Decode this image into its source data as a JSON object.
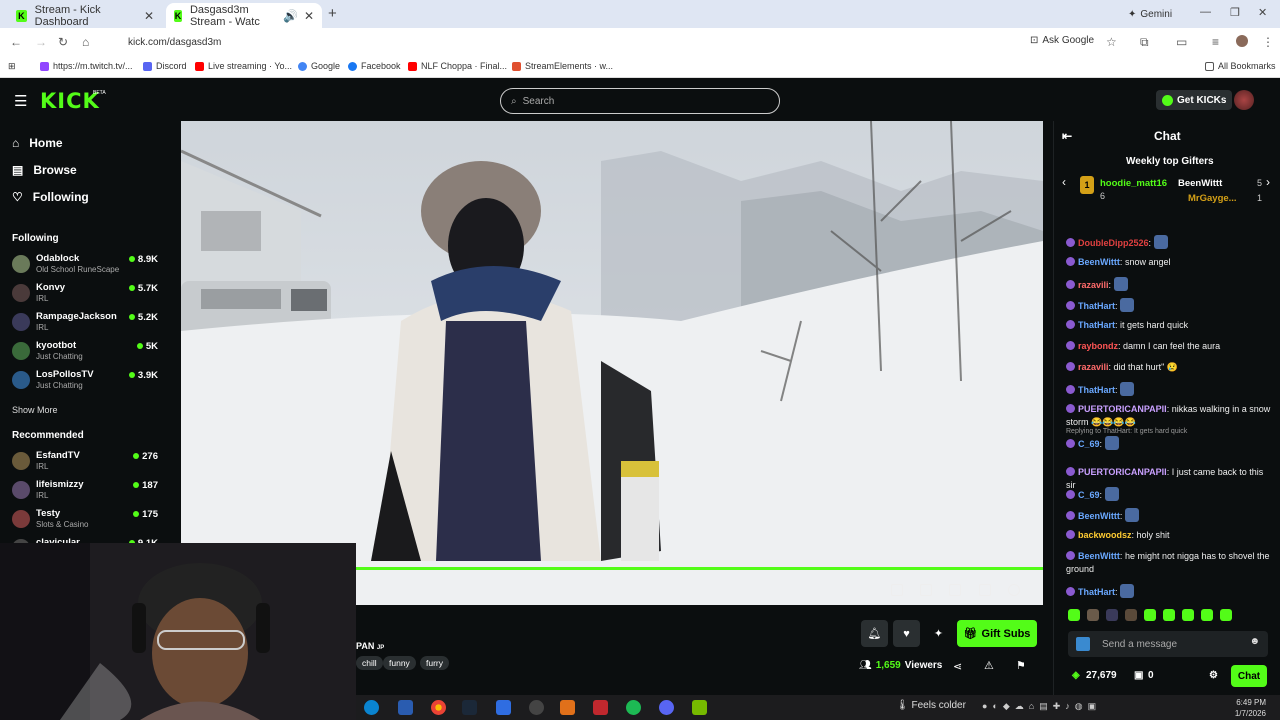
{
  "browser": {
    "tabs": [
      {
        "title": "Stream - Kick Dashboard"
      },
      {
        "title": "Dasgasd3m Stream - Watc"
      }
    ],
    "url": "kick.com/dasgasd3m",
    "gemini_label": "Gemini",
    "ask_google_label": "Ask Google",
    "bookmarks": [
      "https://m.twitch.tv/...",
      "Discord",
      "Live streaming · Yo...",
      "Google",
      "Facebook",
      "NLF Choppa · Final...",
      "StreamElements · w..."
    ],
    "all_bookmarks_label": "All Bookmarks"
  },
  "kick": {
    "logo": "KICK",
    "beta": "BETA",
    "search_placeholder": "Search",
    "get_kicks_label": "Get KICKs"
  },
  "sidebar": {
    "nav": [
      {
        "label": "Home",
        "icon": "home-icon"
      },
      {
        "label": "Browse",
        "icon": "browse-icon"
      },
      {
        "label": "Following",
        "icon": "heart-icon"
      }
    ],
    "following_header": "Following",
    "following": [
      {
        "name": "Odablock",
        "category": "Old School RuneScape",
        "viewers": "8.9K",
        "color": "#6a7a5a"
      },
      {
        "name": "Konvy",
        "category": "IRL",
        "viewers": "5.7K",
        "color": "#4a3a3a"
      },
      {
        "name": "RampageJackson",
        "category": "IRL",
        "viewers": "5.2K",
        "color": "#3a3a5a"
      },
      {
        "name": "kyootbot",
        "category": "Just Chatting",
        "viewers": "5K",
        "color": "#3a6a3a"
      },
      {
        "name": "LosPollosTV",
        "category": "Just Chatting",
        "viewers": "3.9K",
        "color": "#2a5a8a"
      }
    ],
    "show_more_label": "Show More",
    "recommended_header": "Recommended",
    "recommended": [
      {
        "name": "EsfandTV",
        "category": "IRL",
        "viewers": "276",
        "color": "#6a5a3a"
      },
      {
        "name": "lifeismizzy",
        "category": "IRL",
        "viewers": "187",
        "color": "#5a4a6a"
      },
      {
        "name": "Testy",
        "category": "Slots & Casino",
        "viewers": "175",
        "color": "#7a3a3a"
      },
      {
        "name": "clavicular",
        "category": "",
        "viewers": "9.1K",
        "color": "#444"
      }
    ]
  },
  "stream": {
    "title": "PAN",
    "flag": "JP",
    "tags": [
      "chill",
      "funny",
      "furry"
    ],
    "viewers": "1,659",
    "viewers_label": "Viewers",
    "gift_subs_label": "Gift Subs",
    "progress": 1.0
  },
  "chat": {
    "title": "Chat",
    "weekly_header": "Weekly top Gifters",
    "gifters": [
      {
        "rank": "1",
        "name": "hoodie_matt16",
        "count": "6"
      },
      {
        "rank": "",
        "name": "BeenWittt",
        "count": "5"
      },
      {
        "rank": "",
        "name": "MrGayge...",
        "count": "1"
      }
    ],
    "messages": [
      {
        "user": "DoubleDipp2526",
        "text": "",
        "color": "#e04040"
      },
      {
        "user": "BeenWittt",
        "text": "snow angel",
        "color": "#6aa8ff"
      },
      {
        "user": "razavili",
        "text": "",
        "color": "#ff6b6b"
      },
      {
        "user": "ThatHart",
        "text": "",
        "color": "#6aa8ff"
      },
      {
        "user": "ThatHart",
        "text": "it gets hard quick",
        "color": "#6aa8ff"
      },
      {
        "user": "raybondz",
        "text": "damn I can feel the aura",
        "color": "#ff5555"
      },
      {
        "user": "razavili",
        "text": "did that hurt\" 😢",
        "color": "#ff6b6b"
      },
      {
        "user": "ThatHart",
        "text": "",
        "color": "#6aa8ff"
      },
      {
        "user": "PUERTORICANPAPII",
        "text": "nikkas walking in a snow storm 😂😂😂😂",
        "color": "#c9a0ff"
      },
      {
        "user": "C_69",
        "text": "",
        "color": "#6aa8ff",
        "reply": "Replying to ThatHart: It gets hard quick"
      },
      {
        "user": "PUERTORICANPAPII",
        "text": "I just came back to this sir",
        "color": "#c9a0ff"
      },
      {
        "user": "C_69",
        "text": "",
        "color": "#6aa8ff"
      },
      {
        "user": "BeenWittt",
        "text": "",
        "color": "#6aa8ff"
      },
      {
        "user": "backwoodsz",
        "text": "holy shit",
        "color": "#ffcc33"
      },
      {
        "user": "BeenWittt",
        "text": "he might not nigga has to shovel the ground",
        "color": "#6aa8ff"
      },
      {
        "user": "ThatHart",
        "text": "",
        "color": "#6aa8ff"
      }
    ],
    "send_placeholder": "Send a message",
    "kicks_balance": "27,679",
    "gifts_count": "0",
    "chat_button": "Chat"
  },
  "taskbar": {
    "weather": "Feels colder",
    "time": "6:49 PM",
    "date": "1/7/2026"
  },
  "colors": {
    "accent": "#53fc18",
    "background": "#0b0e0f"
  }
}
